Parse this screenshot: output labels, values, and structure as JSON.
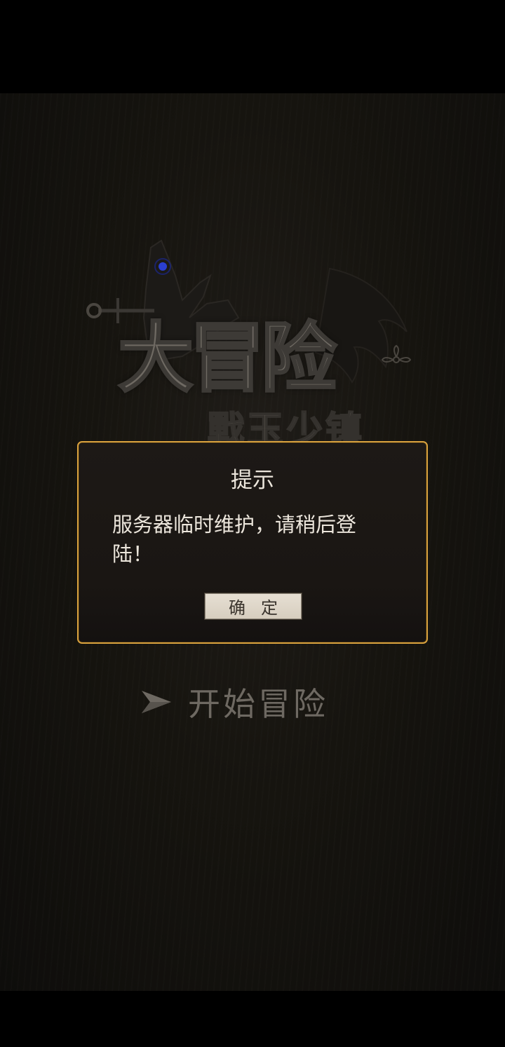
{
  "logo": {
    "title": "大冒险",
    "subtitle": "戰玉少镇"
  },
  "start_button": {
    "label": "开始冒险",
    "icon": "arrow-right-icon"
  },
  "dialog": {
    "title": "提示",
    "message": "服务器临时维护，请稍后登陆！",
    "confirm_label": "确定",
    "border_color": "#d9a23e"
  },
  "colors": {
    "background": "#16140f",
    "dialog_text": "#ece6dc",
    "start_text": "#6e6962"
  }
}
